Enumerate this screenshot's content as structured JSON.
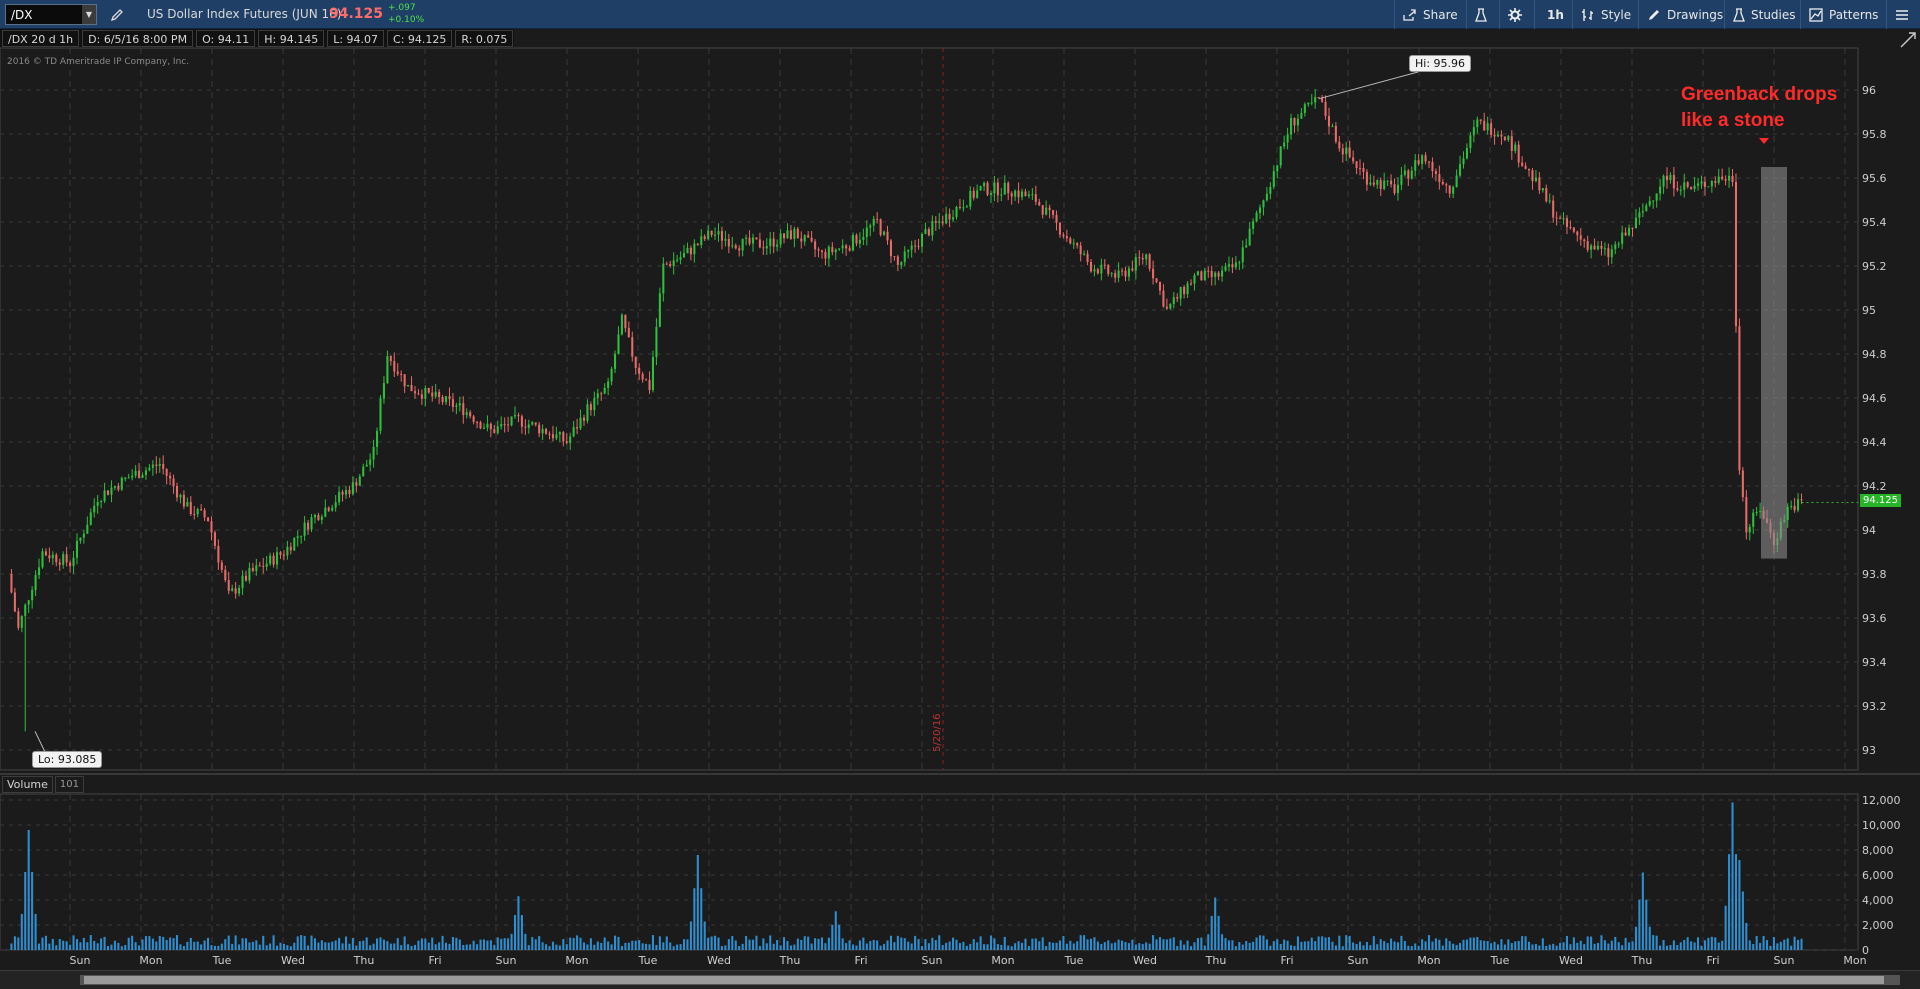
{
  "toolbar": {
    "symbol": "/DX",
    "instrument_name": "US Dollar Index Futures (JUN 16)",
    "last_price": "94.125",
    "change_abs": "+.097",
    "change_pct": "+0.10%",
    "buttons": [
      {
        "label": "Share",
        "icon": "share-icon"
      },
      {
        "label": "",
        "icon": "flask-icon"
      },
      {
        "label": "",
        "icon": "gear-icon"
      },
      {
        "label": "1h",
        "icon": ""
      },
      {
        "label": "Style",
        "icon": "style-icon"
      },
      {
        "label": "Drawings",
        "icon": "pencil-icon"
      },
      {
        "label": "Studies",
        "icon": "flask-icon"
      },
      {
        "label": "Patterns",
        "icon": "patterns-icon"
      }
    ]
  },
  "info_bar": {
    "title": "/DX 20 d 1h",
    "date": "D: 6/5/16 8:00 PM",
    "open": "O: 94.11",
    "high": "H: 94.145",
    "low": "L: 94.07",
    "close": "C: 94.125",
    "range": "R: 0.075"
  },
  "copyright": "2016 © TD Ameritrade IP Company, Inc.",
  "annotation": {
    "line1": "Greenback drops",
    "line2": "like a stone"
  },
  "callouts": {
    "high": "Hi: 95.96",
    "low": "Lo: 93.085",
    "price_tag": "94.125",
    "date_marker": "5/20/16"
  },
  "volume": {
    "label": "Volume",
    "value": "101"
  },
  "colors": {
    "up": "#2fbf3f",
    "down": "#e86a6a",
    "background": "#1b1b1b",
    "grid": "#3a3a3a",
    "annotation": "#ff2b2b",
    "volume": "#2e8fd0"
  },
  "chart_data": {
    "type": "candlestick",
    "title": "/DX 20 d 1h",
    "price_axis": {
      "ylim": [
        93.0,
        96.1
      ],
      "ticks": [
        "96",
        "95.8",
        "95.6",
        "95.4",
        "95.2",
        "95",
        "94.8",
        "94.6",
        "94.4",
        "94.2",
        "94",
        "93.8",
        "93.6",
        "93.4",
        "93.2",
        "93"
      ]
    },
    "volume_axis": {
      "ylim": [
        0,
        12000
      ],
      "ticks": [
        "12,000",
        "10,000",
        "8,000",
        "6,000",
        "4,000",
        "2,000",
        "0"
      ]
    },
    "x_labels": [
      "Sun",
      "Mon",
      "Tue",
      "Wed",
      "Thu",
      "Fri",
      "Sun",
      "Mon",
      "Tue",
      "Wed",
      "Thu",
      "Fri",
      "Sun",
      "Mon",
      "Tue",
      "Wed",
      "Thu",
      "Fri",
      "Sun",
      "Mon",
      "Tue",
      "Wed",
      "Thu",
      "Fri",
      "Sun",
      "Mon"
    ],
    "close_path": [
      [
        0,
        93.8
      ],
      [
        3,
        93.55
      ],
      [
        6,
        93.7
      ],
      [
        10,
        93.9
      ],
      [
        18,
        93.85
      ],
      [
        26,
        94.15
      ],
      [
        36,
        94.25
      ],
      [
        44,
        94.3
      ],
      [
        52,
        94.1
      ],
      [
        58,
        94.05
      ],
      [
        64,
        93.7
      ],
      [
        70,
        93.8
      ],
      [
        80,
        93.9
      ],
      [
        88,
        94.05
      ],
      [
        96,
        94.15
      ],
      [
        100,
        94.2
      ],
      [
        106,
        94.35
      ],
      [
        110,
        94.8
      ],
      [
        116,
        94.65
      ],
      [
        124,
        94.6
      ],
      [
        132,
        94.55
      ],
      [
        140,
        94.45
      ],
      [
        148,
        94.5
      ],
      [
        156,
        94.45
      ],
      [
        162,
        94.4
      ],
      [
        168,
        94.55
      ],
      [
        174,
        94.65
      ],
      [
        178,
        94.95
      ],
      [
        182,
        94.75
      ],
      [
        186,
        94.65
      ],
      [
        190,
        95.2
      ],
      [
        196,
        95.25
      ],
      [
        204,
        95.35
      ],
      [
        212,
        95.3
      ],
      [
        220,
        95.3
      ],
      [
        228,
        95.35
      ],
      [
        236,
        95.25
      ],
      [
        244,
        95.3
      ],
      [
        252,
        95.4
      ],
      [
        258,
        95.2
      ],
      [
        266,
        95.35
      ],
      [
        274,
        95.45
      ],
      [
        282,
        95.55
      ],
      [
        290,
        95.55
      ],
      [
        298,
        95.5
      ],
      [
        306,
        95.35
      ],
      [
        314,
        95.2
      ],
      [
        322,
        95.15
      ],
      [
        330,
        95.25
      ],
      [
        336,
        95.0
      ],
      [
        344,
        95.15
      ],
      [
        350,
        95.15
      ],
      [
        356,
        95.2
      ],
      [
        364,
        95.5
      ],
      [
        372,
        95.85
      ],
      [
        380,
        95.96
      ],
      [
        386,
        95.75
      ],
      [
        394,
        95.6
      ],
      [
        402,
        95.55
      ],
      [
        410,
        95.7
      ],
      [
        418,
        95.55
      ],
      [
        426,
        95.85
      ],
      [
        434,
        95.8
      ],
      [
        442,
        95.6
      ],
      [
        450,
        95.4
      ],
      [
        458,
        95.3
      ],
      [
        464,
        95.25
      ],
      [
        472,
        95.4
      ],
      [
        480,
        95.6
      ],
      [
        488,
        95.55
      ],
      [
        496,
        95.6
      ],
      [
        500,
        95.6
      ],
      [
        502,
        94.3
      ],
      [
        504,
        94.0
      ],
      [
        508,
        94.1
      ],
      [
        512,
        93.95
      ],
      [
        516,
        94.1
      ],
      [
        520,
        94.125
      ]
    ],
    "high": 95.96,
    "low": 93.085,
    "last": 94.125,
    "volume_spikes": [
      [
        6,
        9600
      ],
      [
        148,
        4300
      ],
      [
        200,
        7600
      ],
      [
        240,
        3100
      ],
      [
        350,
        4200
      ],
      [
        474,
        6200
      ],
      [
        500,
        11800
      ],
      [
        502,
        7200
      ]
    ]
  }
}
